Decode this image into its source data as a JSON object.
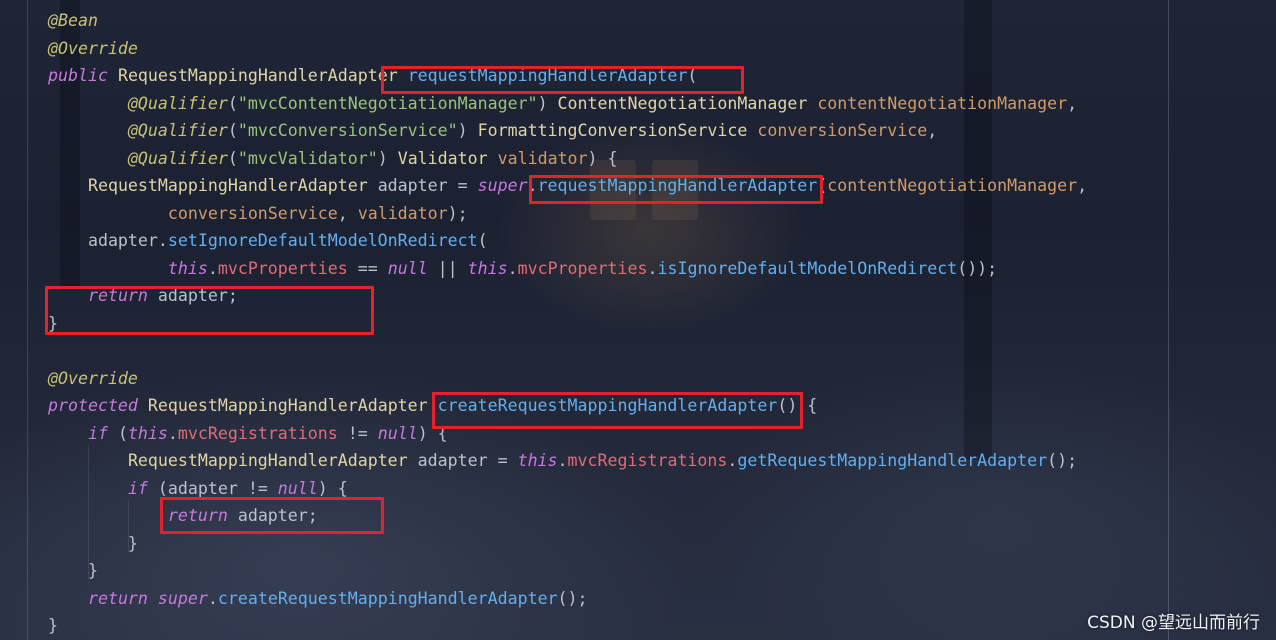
{
  "theme": {
    "annotation": "#c9c172",
    "keyword": "#c678dd",
    "type": "#e0d4a4",
    "method": "#61afef",
    "string": "#98c379",
    "param": "#d19a66",
    "field": "#e06c75",
    "plain": "#bcc0c9",
    "highlight": "#e4222b"
  },
  "editor": {
    "lines": [
      {
        "tokens": [
          {
            "kind": "annotation",
            "text": "@Bean"
          }
        ]
      },
      {
        "tokens": [
          {
            "kind": "annotation",
            "text": "@Override"
          }
        ]
      },
      {
        "tokens": [
          {
            "kind": "keyword",
            "text": "public"
          },
          {
            "kind": "plain",
            "text": " "
          },
          {
            "kind": "type",
            "text": "RequestMappingHandlerAdapter"
          },
          {
            "kind": "plain",
            "text": " "
          },
          {
            "kind": "method",
            "text": "requestMappingHandlerAdapter"
          },
          {
            "kind": "plain",
            "text": "("
          }
        ]
      },
      {
        "tokens": [
          {
            "kind": "plain",
            "text": "        "
          },
          {
            "kind": "annotation",
            "text": "@Qualifier"
          },
          {
            "kind": "plain",
            "text": "("
          },
          {
            "kind": "string",
            "text": "\"mvcContentNegotiationManager\""
          },
          {
            "kind": "plain",
            "text": ") "
          },
          {
            "kind": "type",
            "text": "ContentNegotiationManager"
          },
          {
            "kind": "plain",
            "text": " "
          },
          {
            "kind": "param",
            "text": "contentNegotiationManager"
          },
          {
            "kind": "plain",
            "text": ","
          }
        ]
      },
      {
        "tokens": [
          {
            "kind": "plain",
            "text": "        "
          },
          {
            "kind": "annotation",
            "text": "@Qualifier"
          },
          {
            "kind": "plain",
            "text": "("
          },
          {
            "kind": "string",
            "text": "\"mvcConversionService\""
          },
          {
            "kind": "plain",
            "text": ") "
          },
          {
            "kind": "type",
            "text": "FormattingConversionService"
          },
          {
            "kind": "plain",
            "text": " "
          },
          {
            "kind": "param",
            "text": "conversionService"
          },
          {
            "kind": "plain",
            "text": ","
          }
        ]
      },
      {
        "tokens": [
          {
            "kind": "plain",
            "text": "        "
          },
          {
            "kind": "annotation",
            "text": "@Qualifier"
          },
          {
            "kind": "plain",
            "text": "("
          },
          {
            "kind": "string",
            "text": "\"mvcValidator\""
          },
          {
            "kind": "plain",
            "text": ") "
          },
          {
            "kind": "type",
            "text": "Validator"
          },
          {
            "kind": "plain",
            "text": " "
          },
          {
            "kind": "param",
            "text": "validator"
          },
          {
            "kind": "plain",
            "text": ") {"
          }
        ]
      },
      {
        "tokens": [
          {
            "kind": "plain",
            "text": "    "
          },
          {
            "kind": "type",
            "text": "RequestMappingHandlerAdapter"
          },
          {
            "kind": "plain",
            "text": " adapter = "
          },
          {
            "kind": "keyword",
            "text": "super"
          },
          {
            "kind": "plain",
            "text": "."
          },
          {
            "kind": "method",
            "text": "requestMappingHandlerAdapter"
          },
          {
            "kind": "plain",
            "text": "("
          },
          {
            "kind": "param",
            "text": "contentNegotiationManager"
          },
          {
            "kind": "plain",
            "text": ","
          }
        ]
      },
      {
        "tokens": [
          {
            "kind": "plain",
            "text": "            "
          },
          {
            "kind": "param",
            "text": "conversionService"
          },
          {
            "kind": "plain",
            "text": ", "
          },
          {
            "kind": "param",
            "text": "validator"
          },
          {
            "kind": "plain",
            "text": ");"
          }
        ]
      },
      {
        "tokens": [
          {
            "kind": "plain",
            "text": "    adapter."
          },
          {
            "kind": "method",
            "text": "setIgnoreDefaultModelOnRedirect"
          },
          {
            "kind": "plain",
            "text": "("
          }
        ]
      },
      {
        "tokens": [
          {
            "kind": "plain",
            "text": "            "
          },
          {
            "kind": "keyword",
            "text": "this"
          },
          {
            "kind": "plain",
            "text": "."
          },
          {
            "kind": "field",
            "text": "mvcProperties"
          },
          {
            "kind": "plain",
            "text": " == "
          },
          {
            "kind": "keyword",
            "text": "null"
          },
          {
            "kind": "plain",
            "text": " || "
          },
          {
            "kind": "keyword",
            "text": "this"
          },
          {
            "kind": "plain",
            "text": "."
          },
          {
            "kind": "field",
            "text": "mvcProperties"
          },
          {
            "kind": "plain",
            "text": "."
          },
          {
            "kind": "method",
            "text": "isIgnoreDefaultModelOnRedirect"
          },
          {
            "kind": "plain",
            "text": "());"
          }
        ]
      },
      {
        "tokens": [
          {
            "kind": "plain",
            "text": "    "
          },
          {
            "kind": "keyword",
            "text": "return"
          },
          {
            "kind": "plain",
            "text": " adapter;"
          }
        ]
      },
      {
        "tokens": [
          {
            "kind": "plain",
            "text": "}"
          }
        ]
      },
      {
        "tokens": []
      },
      {
        "tokens": [
          {
            "kind": "annotation",
            "text": "@Override"
          }
        ]
      },
      {
        "tokens": [
          {
            "kind": "keyword",
            "text": "protected"
          },
          {
            "kind": "plain",
            "text": " "
          },
          {
            "kind": "type",
            "text": "RequestMappingHandlerAdapter"
          },
          {
            "kind": "plain",
            "text": " "
          },
          {
            "kind": "method",
            "text": "createRequestMappingHandlerAdapter"
          },
          {
            "kind": "plain",
            "text": "() {"
          }
        ]
      },
      {
        "tokens": [
          {
            "kind": "plain",
            "text": "    "
          },
          {
            "kind": "keyword",
            "text": "if"
          },
          {
            "kind": "plain",
            "text": " ("
          },
          {
            "kind": "keyword",
            "text": "this"
          },
          {
            "kind": "plain",
            "text": "."
          },
          {
            "kind": "field",
            "text": "mvcRegistrations"
          },
          {
            "kind": "plain",
            "text": " != "
          },
          {
            "kind": "keyword",
            "text": "null"
          },
          {
            "kind": "plain",
            "text": ") {"
          }
        ]
      },
      {
        "tokens": [
          {
            "kind": "plain",
            "text": "        "
          },
          {
            "kind": "type",
            "text": "RequestMappingHandlerAdapter"
          },
          {
            "kind": "plain",
            "text": " adapter = "
          },
          {
            "kind": "keyword",
            "text": "this"
          },
          {
            "kind": "plain",
            "text": "."
          },
          {
            "kind": "field",
            "text": "mvcRegistrations"
          },
          {
            "kind": "plain",
            "text": "."
          },
          {
            "kind": "method",
            "text": "getRequestMappingHandlerAdapter"
          },
          {
            "kind": "plain",
            "text": "();"
          }
        ]
      },
      {
        "tokens": [
          {
            "kind": "plain",
            "text": "        "
          },
          {
            "kind": "keyword",
            "text": "if"
          },
          {
            "kind": "plain",
            "text": " (adapter != "
          },
          {
            "kind": "keyword",
            "text": "null"
          },
          {
            "kind": "plain",
            "text": ") {"
          }
        ]
      },
      {
        "tokens": [
          {
            "kind": "plain",
            "text": "            "
          },
          {
            "kind": "keyword",
            "text": "return"
          },
          {
            "kind": "plain",
            "text": " adapter;"
          }
        ]
      },
      {
        "tokens": [
          {
            "kind": "plain",
            "text": "        }"
          }
        ]
      },
      {
        "tokens": [
          {
            "kind": "plain",
            "text": "    }"
          }
        ]
      },
      {
        "tokens": [
          {
            "kind": "plain",
            "text": "    "
          },
          {
            "kind": "keyword",
            "text": "return"
          },
          {
            "kind": "plain",
            "text": " "
          },
          {
            "kind": "keyword",
            "text": "super"
          },
          {
            "kind": "plain",
            "text": "."
          },
          {
            "kind": "method",
            "text": "createRequestMappingHandlerAdapter"
          },
          {
            "kind": "plain",
            "text": "();"
          }
        ]
      },
      {
        "tokens": [
          {
            "kind": "plain",
            "text": "}"
          }
        ]
      }
    ]
  },
  "watermark": {
    "text": "CSDN @望远山而前行"
  }
}
